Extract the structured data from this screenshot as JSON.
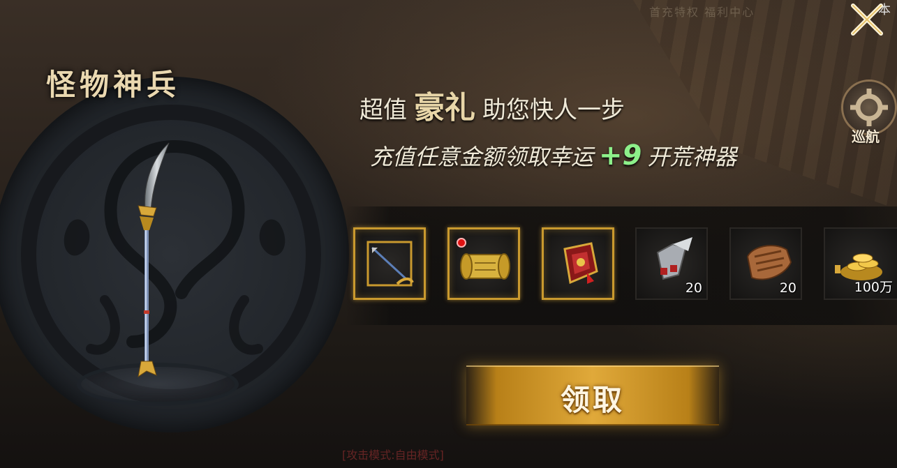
{
  "header": {
    "faded_menu_text": "首充特权 福利中心",
    "corner_char": "本"
  },
  "panel": {
    "title": "怪物神兵",
    "headline_prefix": "超值",
    "headline_emphasis": "豪礼",
    "headline_suffix": "助您快人一步",
    "sub_prefix": "充值任意金额领取幸运",
    "sub_bonus": "+9",
    "sub_suffix": "开荒神器"
  },
  "rewards": [
    {
      "icon": "bow-icon",
      "frame": "gold",
      "qty": ""
    },
    {
      "icon": "scroll-icon",
      "frame": "gold",
      "qty": "",
      "badge": "red-dot"
    },
    {
      "icon": "armor-icon",
      "frame": "gold",
      "qty": ""
    },
    {
      "icon": "gauntlet-icon",
      "frame": "plain",
      "qty": "20"
    },
    {
      "icon": "material-stone-icon",
      "frame": "plain",
      "qty": "20"
    },
    {
      "icon": "gold-coins-icon",
      "frame": "plain",
      "qty": "100万"
    }
  ],
  "claim_button": {
    "label": "领取"
  },
  "side_nav": {
    "label": "巡航"
  },
  "footer": {
    "mode_text": "[攻击模式:自由模式]"
  },
  "colors": {
    "accent_gold": "#e0a93a",
    "bonus_green": "#8df08a",
    "title_cream": "#ead8b0"
  }
}
